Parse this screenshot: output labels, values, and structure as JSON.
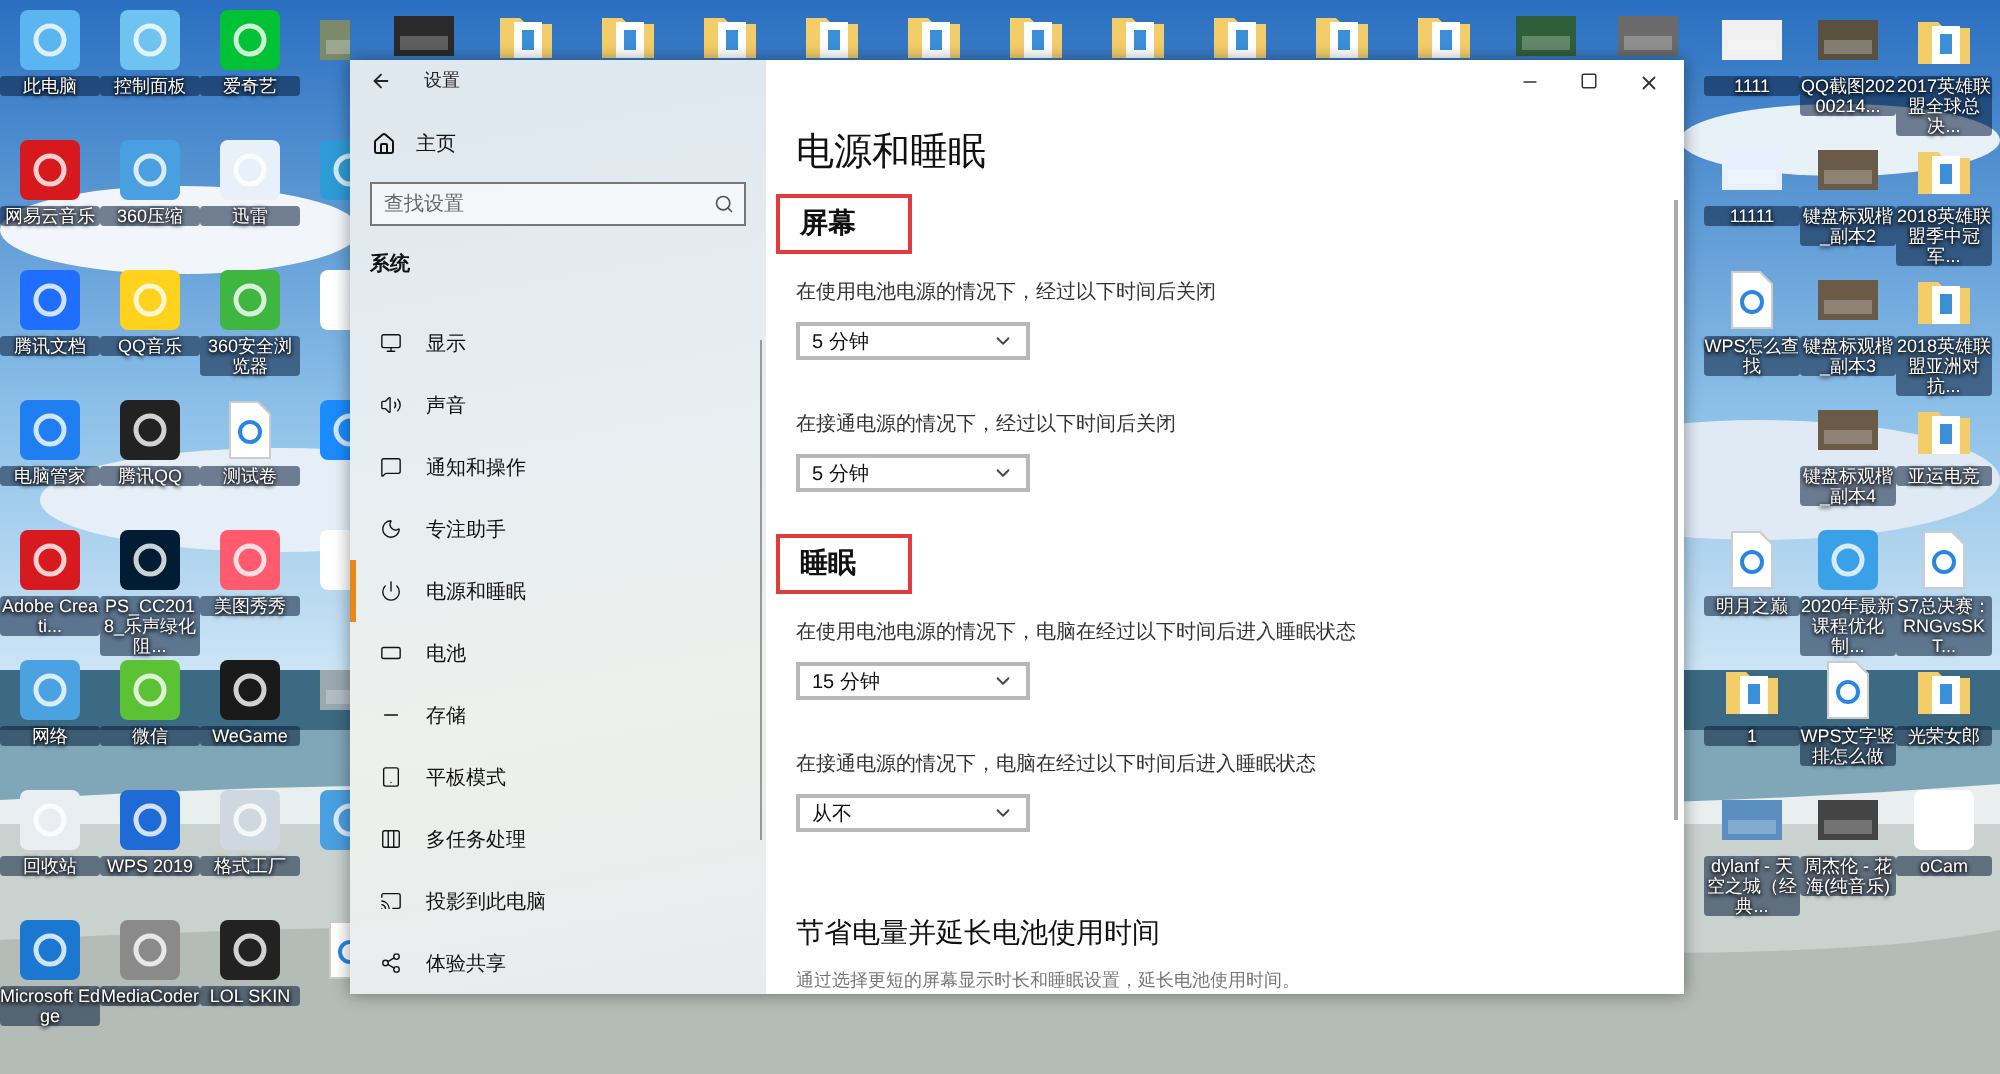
{
  "desktop": {
    "top_icons": [
      {
        "kind": "thumb",
        "color": "#2a2a2a"
      },
      {
        "kind": "folder",
        "color": "#f3cd6a"
      },
      {
        "kind": "folder",
        "color": "#f3cd6a"
      },
      {
        "kind": "folder",
        "color": "#f3cd6a"
      },
      {
        "kind": "folder",
        "color": "#f3cd6a"
      },
      {
        "kind": "folder",
        "color": "#f3cd6a"
      },
      {
        "kind": "folder",
        "color": "#f3cd6a"
      },
      {
        "kind": "folder",
        "color": "#f3cd6a"
      },
      {
        "kind": "folder",
        "color": "#f3cd6a"
      },
      {
        "kind": "folder",
        "color": "#f3cd6a"
      },
      {
        "kind": "folder",
        "color": "#f3cd6a"
      },
      {
        "kind": "thumb",
        "color": "#2f5f3a"
      },
      {
        "kind": "thumb",
        "color": "#6a6a6a"
      }
    ],
    "left_rows": [
      {
        "cells": [
          {
            "label": "此电脑",
            "kind": "app",
            "color": "#5bb5f0"
          },
          {
            "label": "控制面板",
            "kind": "app",
            "color": "#6fc3f0"
          },
          {
            "label": "爱奇艺",
            "kind": "app",
            "color": "#00c234"
          },
          {
            "kind": "thumb",
            "color": "#7a8a6a"
          }
        ]
      },
      {
        "cells": [
          {
            "label": "网易云音乐",
            "kind": "app",
            "color": "#d7191e"
          },
          {
            "label": "360压缩",
            "kind": "app",
            "color": "#4a9fe0"
          },
          {
            "label": "迅雷",
            "kind": "app",
            "color": "#e8f0fa"
          },
          {
            "kind": "app",
            "color": "#2e9bd6"
          }
        ]
      },
      {
        "cells": [
          {
            "label": "腾讯文档",
            "kind": "app",
            "color": "#1e6fff"
          },
          {
            "label": "QQ音乐",
            "kind": "app",
            "color": "#ffd21e"
          },
          {
            "label": "360安全浏览器",
            "kind": "app",
            "color": "#3fb63f"
          },
          {
            "kind": "app",
            "color": "#ffffff"
          }
        ]
      },
      {
        "cells": [
          {
            "label": "电脑管家",
            "kind": "app",
            "color": "#1f7ff0"
          },
          {
            "label": "腾讯QQ",
            "kind": "app",
            "color": "#222222"
          },
          {
            "label": "测试卷",
            "kind": "file",
            "color": "#ffffff"
          },
          {
            "kind": "app",
            "color": "#1a8cff"
          }
        ]
      },
      {
        "cells": [
          {
            "label": "Adobe Creati...",
            "kind": "app",
            "color": "#d71920"
          },
          {
            "label": "PS_CC2018_乐声绿化阻...",
            "kind": "app",
            "color": "#001d34"
          },
          {
            "label": "美图秀秀",
            "kind": "app",
            "color": "#ff5a6e"
          },
          {
            "kind": "app",
            "color": "#ffffff"
          }
        ]
      },
      {
        "cells": [
          {
            "label": "网络",
            "kind": "app",
            "color": "#4aa3e0"
          },
          {
            "label": "微信",
            "kind": "app",
            "color": "#5bc236"
          },
          {
            "label": "WeGame",
            "kind": "app",
            "color": "#1a1a1a"
          },
          {
            "kind": "thumb",
            "color": "#9aa8b0"
          }
        ]
      },
      {
        "cells": [
          {
            "label": "回收站",
            "kind": "app",
            "color": "#e8eef2"
          },
          {
            "label": "WPS 2019",
            "kind": "app",
            "color": "#1e6bd6"
          },
          {
            "label": "格式工厂",
            "kind": "app",
            "color": "#cfd8e0"
          },
          {
            "kind": "app",
            "color": "#4a9fe0"
          }
        ]
      },
      {
        "cells": [
          {
            "label": "Microsoft Edge",
            "kind": "app",
            "color": "#1c77d0"
          },
          {
            "label": "MediaCoder",
            "kind": "app",
            "color": "#8a8a8a"
          },
          {
            "label": "LOL SKIN",
            "kind": "app",
            "color": "#222222"
          },
          {
            "kind": "file",
            "color": "#ffffff"
          }
        ]
      }
    ],
    "right_rows": [
      {
        "cells": [
          {
            "label": "1111",
            "kind": "thumb",
            "color": "#f0f0f0"
          },
          {
            "label": "QQ截图20200214...",
            "kind": "thumb",
            "color": "#5a5040"
          },
          {
            "label": "2017英雄联盟全球总决...",
            "kind": "folder",
            "color": "#f3cd6a"
          }
        ]
      },
      {
        "cells": [
          {
            "label": "11111",
            "kind": "thumb",
            "color": "#e8f0ff"
          },
          {
            "label": "键盘标观楷_副本2",
            "kind": "thumb",
            "color": "#6a5a48"
          },
          {
            "label": "2018英雄联盟季中冠军...",
            "kind": "folder",
            "color": "#f3cd6a"
          }
        ]
      },
      {
        "cells": [
          {
            "label": "WPS怎么查找",
            "kind": "file",
            "color": "#ffffff"
          },
          {
            "label": "键盘标观楷_副本3",
            "kind": "thumb",
            "color": "#6a5a48"
          },
          {
            "label": "2018英雄联盟亚洲对抗...",
            "kind": "folder",
            "color": "#f3cd6a"
          }
        ]
      },
      {
        "cells": [
          {
            "label": "键盘标观楷_副本4",
            "kind": "thumb",
            "color": "#6a5a48"
          },
          {
            "label": "亚运电竞",
            "kind": "folder",
            "color": "#f3cd6a"
          }
        ]
      },
      {
        "cells": [
          {
            "label": "明月之巅",
            "kind": "file",
            "color": "#ffffff"
          },
          {
            "label": "2020年最新课程优化制...",
            "kind": "app",
            "color": "#3aa0e8"
          },
          {
            "label": "S7总决赛：RNGvsSKT...",
            "kind": "file",
            "color": "#ffffff"
          }
        ]
      },
      {
        "cells": [
          {
            "label": "1",
            "kind": "folder",
            "color": "#f3cd6a"
          },
          {
            "label": "WPS文字竖排怎么做",
            "kind": "file",
            "color": "#ffffff"
          },
          {
            "label": "光荣女郎",
            "kind": "folder",
            "color": "#f3cd6a"
          }
        ]
      },
      {
        "cells": [
          {
            "label": "dylanf - 天空之城（经典...",
            "kind": "thumb",
            "color": "#5a8fc0"
          },
          {
            "label": "周杰伦 - 花海(纯音乐)",
            "kind": "thumb",
            "color": "#444444"
          },
          {
            "label": "oCam",
            "kind": "app",
            "color": "#ffffff"
          }
        ]
      }
    ]
  },
  "window": {
    "title": "设置",
    "home": "主页",
    "search": {
      "placeholder": "查找设置"
    },
    "section": "系统",
    "nav": [
      {
        "label": "显示",
        "selected": false
      },
      {
        "label": "声音",
        "selected": false
      },
      {
        "label": "通知和操作",
        "selected": false
      },
      {
        "label": "专注助手",
        "selected": false
      },
      {
        "label": "电源和睡眠",
        "selected": true
      },
      {
        "label": "电池",
        "selected": false
      },
      {
        "label": "存储",
        "selected": false
      },
      {
        "label": "平板模式",
        "selected": false
      },
      {
        "label": "多任务处理",
        "selected": false
      },
      {
        "label": "投影到此电脑",
        "selected": false
      },
      {
        "label": "体验共享",
        "selected": false
      }
    ],
    "page_title": "电源和睡眠",
    "groups": [
      {
        "heading": "屏幕",
        "highlighted": true,
        "settings": [
          {
            "label": "在使用电池电源的情况下，经过以下时间后关闭",
            "value": "5 分钟"
          },
          {
            "label": "在接通电源的情况下，经过以下时间后关闭",
            "value": "5 分钟"
          }
        ]
      },
      {
        "heading": "睡眠",
        "highlighted": true,
        "settings": [
          {
            "label": "在使用电池电源的情况下，电脑在经过以下时间后进入睡眠状态",
            "value": "15 分钟"
          },
          {
            "label": "在接通电源的情况下，电脑在经过以下时间后进入睡眠状态",
            "value": "从不"
          }
        ]
      }
    ],
    "tip": {
      "heading": "节省电量并延长电池使用时间",
      "text": "通过选择更短的屏幕显示时长和睡眠设置，延长电池使用时间。"
    }
  }
}
